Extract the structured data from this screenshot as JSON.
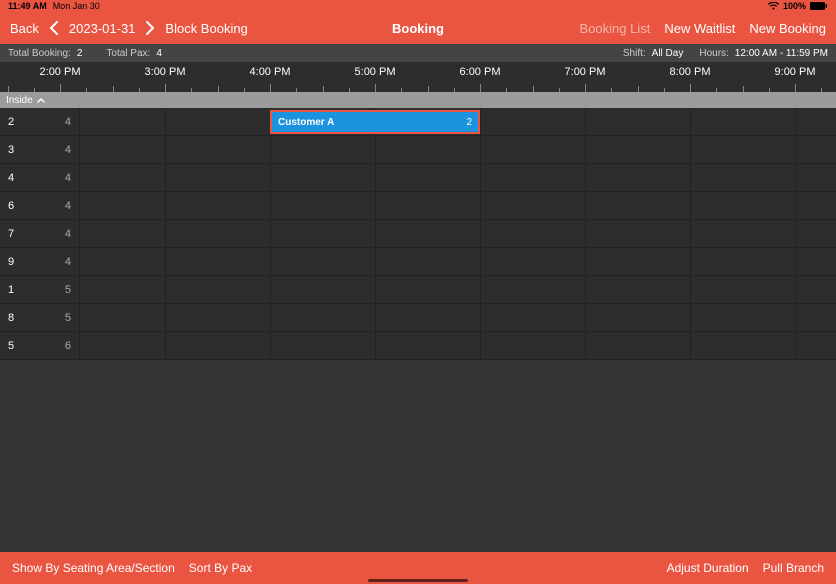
{
  "status": {
    "time": "11:49 AM",
    "date": "Mon Jan 30",
    "battery": "100%"
  },
  "header": {
    "back": "Back",
    "date": "2023-01-31",
    "block_booking": "Block Booking",
    "title": "Booking",
    "booking_list": "Booking List",
    "new_waitlist": "New Waitlist",
    "new_booking": "New Booking"
  },
  "infobar": {
    "total_booking_label": "Total Booking:",
    "total_booking_value": "2",
    "total_pax_label": "Total Pax:",
    "total_pax_value": "4",
    "shift_label": "Shift:",
    "shift_value": "All Day",
    "hours_label": "Hours:",
    "hours_value": "12:00 AM - 11:59 PM"
  },
  "timeline": {
    "labels": [
      "2:00 PM",
      "3:00 PM",
      "4:00 PM",
      "5:00 PM",
      "6:00 PM",
      "7:00 PM",
      "8:00 PM",
      "9:00 PM"
    ]
  },
  "section": {
    "name": "Inside"
  },
  "rows": [
    {
      "table": "2",
      "cap": "4"
    },
    {
      "table": "3",
      "cap": "4"
    },
    {
      "table": "4",
      "cap": "4"
    },
    {
      "table": "6",
      "cap": "4"
    },
    {
      "table": "7",
      "cap": "4"
    },
    {
      "table": "9",
      "cap": "4"
    },
    {
      "table": "1",
      "cap": "5"
    },
    {
      "table": "8",
      "cap": "5"
    },
    {
      "table": "5",
      "cap": "6"
    }
  ],
  "booking": {
    "name": "Customer A",
    "pax": "2"
  },
  "footer": {
    "show_by": "Show By Seating Area/Section",
    "sort_by": "Sort By Pax",
    "adjust": "Adjust Duration",
    "pull": "Pull Branch"
  }
}
